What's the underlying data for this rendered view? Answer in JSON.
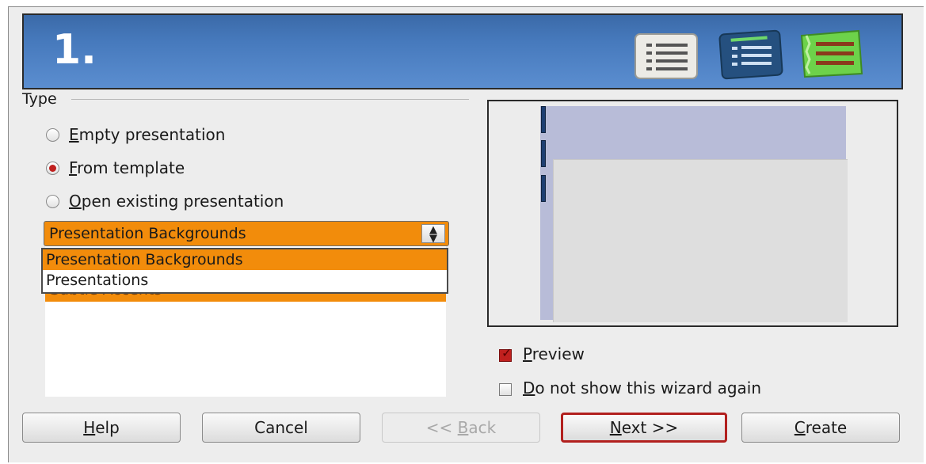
{
  "banner": {
    "step_title": "1.",
    "icons": [
      "list-view-icon",
      "list-accent-icon",
      "list-styled-icon"
    ]
  },
  "type_section": {
    "label": "Type",
    "options": [
      {
        "label_pre": "",
        "label_mnemonic": "E",
        "label_post": "mpty presentation",
        "checked": false
      },
      {
        "label_pre": "",
        "label_mnemonic": "F",
        "label_post": "rom template",
        "checked": true
      },
      {
        "label_pre": "",
        "label_mnemonic": "O",
        "label_post": "pen existing presentation",
        "checked": false
      }
    ]
  },
  "template_combo": {
    "selected": "Presentation Backgrounds",
    "spin_glyph": "▲▼"
  },
  "dropdown": {
    "items": [
      "Presentation Backgrounds",
      "Presentations"
    ],
    "selected_index": 0
  },
  "template_list": {
    "partially_hidden_item": "Subtle Accents"
  },
  "preview_checkbox": {
    "mnemonic": "P",
    "rest": "review",
    "checked": true
  },
  "no_show_checkbox": {
    "mnemonic": "D",
    "rest": "o not show this wizard again",
    "checked": false
  },
  "buttons": {
    "help": {
      "mnemonic": "H",
      "rest": "elp"
    },
    "cancel": {
      "label": "Cancel"
    },
    "back": {
      "pre": "<< ",
      "mnemonic": "B",
      "rest": "ack"
    },
    "next": {
      "mnemonic": "N",
      "rest": "ext >>"
    },
    "create": {
      "mnemonic": "C",
      "rest": "reate"
    }
  },
  "colors": {
    "banner": "#4679bc",
    "selection_orange": "#f28c0b",
    "accent_red": "#c0201e"
  }
}
